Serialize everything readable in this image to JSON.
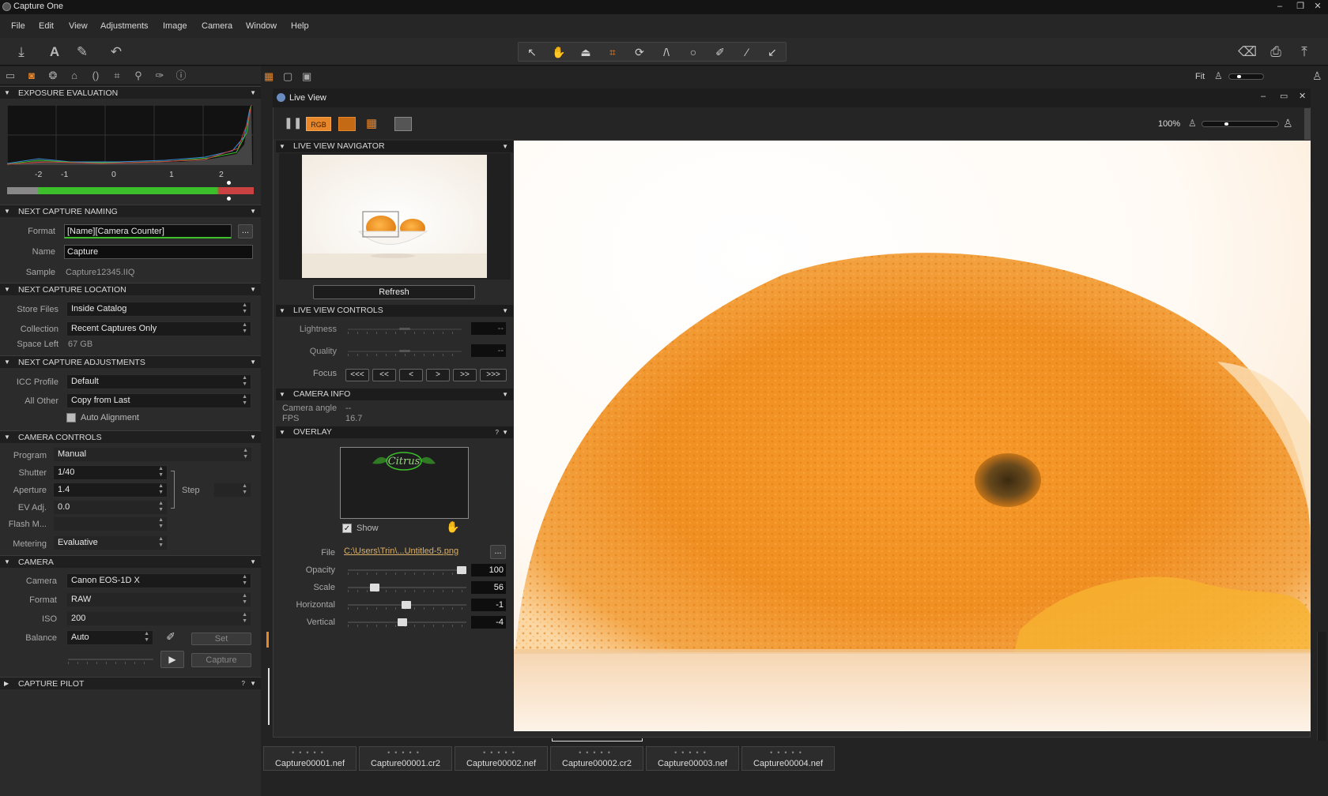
{
  "app": {
    "title": "Capture One",
    "win_min": "‒",
    "win_max": "❐",
    "win_close": "✕"
  },
  "menu": [
    "File",
    "Edit",
    "View",
    "Adjustments",
    "Image",
    "Camera",
    "Window",
    "Help"
  ],
  "viewer_bar": {
    "zoom_label": "Fit"
  },
  "exposure": {
    "title": "EXPOSURE EVALUATION",
    "scale": [
      "-2",
      "-1",
      "0",
      "1",
      "2"
    ]
  },
  "naming": {
    "title": "NEXT CAPTURE NAMING",
    "format_label": "Format",
    "format_value": "[Name][Camera Counter]",
    "name_label": "Name",
    "name_value": "Capture",
    "sample_label": "Sample",
    "sample_value": "Capture12345.IIQ",
    "more": "..."
  },
  "location": {
    "title": "NEXT CAPTURE LOCATION",
    "store_label": "Store Files",
    "store_value": "Inside Catalog",
    "collection_label": "Collection",
    "collection_value": "Recent Captures Only",
    "space_label": "Space Left",
    "space_value": "67 GB"
  },
  "adjustments": {
    "title": "NEXT CAPTURE ADJUSTMENTS",
    "icc_label": "ICC Profile",
    "icc_value": "Default",
    "other_label": "All Other",
    "other_value": "Copy from Last",
    "auto_align": "Auto Alignment"
  },
  "camera_controls": {
    "title": "CAMERA CONTROLS",
    "program_label": "Program",
    "program_value": "Manual",
    "shutter_label": "Shutter",
    "shutter_value": "1/40",
    "aperture_label": "Aperture",
    "aperture_value": "1.4",
    "ev_label": "EV Adj.",
    "ev_value": "0.0",
    "flash_label": "Flash M...",
    "metering_label": "Metering",
    "metering_value": "Evaluative",
    "step_label": "Step"
  },
  "camera": {
    "title": "CAMERA",
    "camera_label": "Camera",
    "camera_value": "Canon EOS-1D X",
    "format_label": "Format",
    "format_value": "RAW",
    "iso_label": "ISO",
    "iso_value": "200",
    "balance_label": "Balance",
    "balance_value": "Auto",
    "set_label": "Set",
    "capture_label": "Capture"
  },
  "pilot": {
    "title": "CAPTURE PILOT",
    "help": "?"
  },
  "liveview": {
    "title": "Live View",
    "rgb": "RGB",
    "zoom": "100%",
    "navigator_title": "LIVE VIEW NAVIGATOR",
    "refresh": "Refresh",
    "controls_title": "LIVE VIEW CONTROLS",
    "lightness_label": "Lightness",
    "lightness_value": "--",
    "quality_label": "Quality",
    "quality_value": "--",
    "focus_label": "Focus",
    "focus_buttons": [
      "<<<",
      "<<",
      "<",
      ">",
      ">>",
      ">>>"
    ],
    "info_title": "CAMERA INFO",
    "angle_label": "Camera angle",
    "angle_value": "--",
    "fps_label": "FPS",
    "fps_value": "16.7",
    "overlay_title": "OVERLAY",
    "overlay_help": "?",
    "show_label": "Show",
    "file_label": "File",
    "file_value": "C:\\Users\\Trin\\...Untitled-5.png",
    "opacity_label": "Opacity",
    "opacity_value": "100",
    "scale_label": "Scale",
    "scale_value": "56",
    "horizontal_label": "Horizontal",
    "horizontal_value": "-1",
    "vertical_label": "Vertical",
    "vertical_value": "-4",
    "overlay_logo_text": "Citrus"
  },
  "slider_levels": {
    "opacity": 1.0,
    "scale": 0.2,
    "horizontal": 0.49,
    "vertical": 0.46,
    "lightness": 0.5,
    "quality": 0.5
  },
  "filmstrip": [
    "Capture00001.nef",
    "Capture00001.cr2",
    "Capture00002.nef",
    "Capture00002.cr2",
    "Capture00003.nef",
    "Capture00004.nef"
  ],
  "colors": {
    "accent": "#e8862a",
    "meter_green": "#3cbf2b",
    "meter_red": "#c94141"
  }
}
